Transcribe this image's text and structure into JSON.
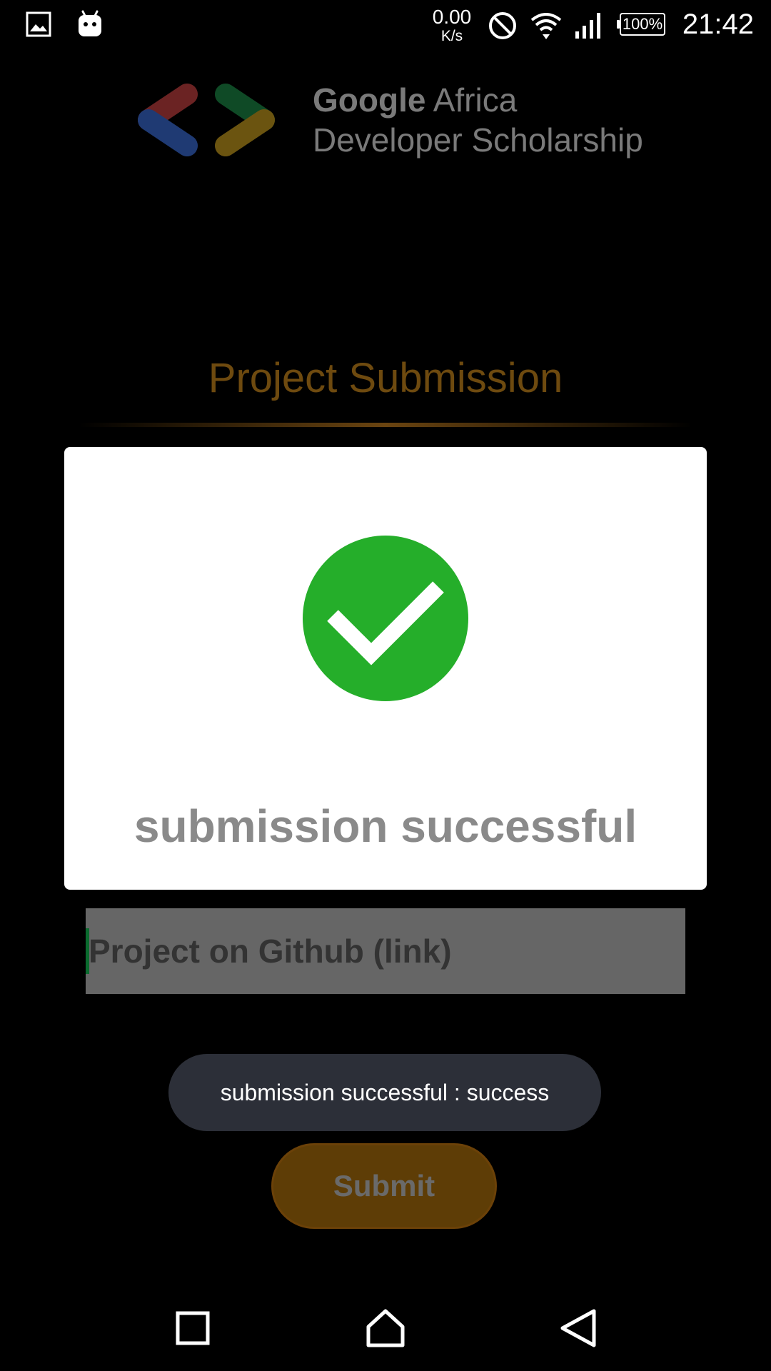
{
  "status_bar": {
    "speed_value": "0.00",
    "speed_unit": "K/s",
    "battery": "100%",
    "time": "21:42",
    "icons": [
      "gallery-icon",
      "android-icon",
      "do-not-disturb-icon",
      "wifi-icon",
      "signal-icon",
      "battery-icon"
    ]
  },
  "header": {
    "logo_line1_bold": "Google",
    "logo_line1_rest": " Africa",
    "logo_line2": "Developer Scholarship"
  },
  "page": {
    "title": "Project Submission"
  },
  "form": {
    "github_placeholder": "Project on Github (link)",
    "submit_label": "Submit"
  },
  "dialog": {
    "message": "submission successful"
  },
  "toast": {
    "message": "submission successful : success"
  },
  "colors": {
    "title": "#6e4a0f",
    "success_green": "#25ae2a",
    "submit_bg": "#5e3d06",
    "toast_bg": "#2c2f38"
  },
  "nav_bar": {
    "icons": [
      "recents-icon",
      "home-icon",
      "back-icon"
    ]
  }
}
